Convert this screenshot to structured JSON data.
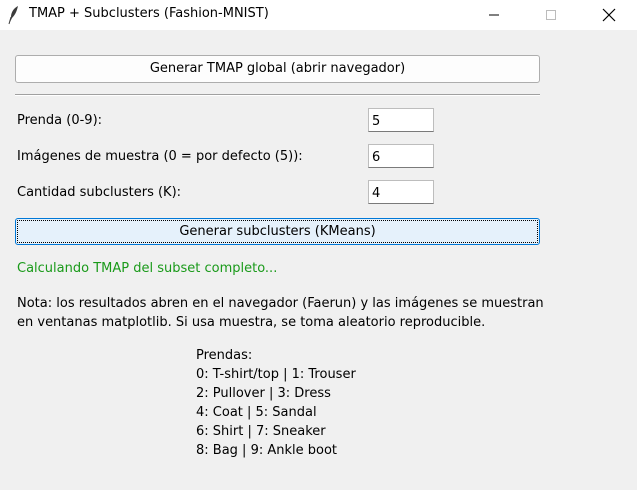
{
  "window": {
    "title": "TMAP + Subclusters (Fashion-MNIST)",
    "icon": "feather-icon"
  },
  "controls": {
    "global_button": "Generar TMAP global (abrir navegador)",
    "fields": [
      {
        "label": "Prenda (0-9):",
        "value": "5"
      },
      {
        "label": "Imágenes de muestra (0 = por defecto (5)):",
        "value": "6"
      },
      {
        "label": "Cantidad subclusters (K):",
        "value": "4"
      }
    ],
    "subclusters_button": "Generar subclusters (KMeans)"
  },
  "status": {
    "text": "Calculando TMAP del subset completo...",
    "color": "#1a9a1a"
  },
  "note": {
    "line1": "Nota: los resultados abren en el navegador (Faerun) y las imágenes se muestran",
    "line2": "en ventanas matplotlib. Si usa muestra, se toma aleatorio reproducible."
  },
  "legend": {
    "title": "Prendas:",
    "lines": [
      "0: T-shirt/top | 1: Trouser",
      "2: Pullover | 3: Dress",
      "4: Coat | 5: Sandal",
      "6: Shirt | 7: Sneaker",
      "8: Bag | 9: Ankle boot"
    ]
  }
}
